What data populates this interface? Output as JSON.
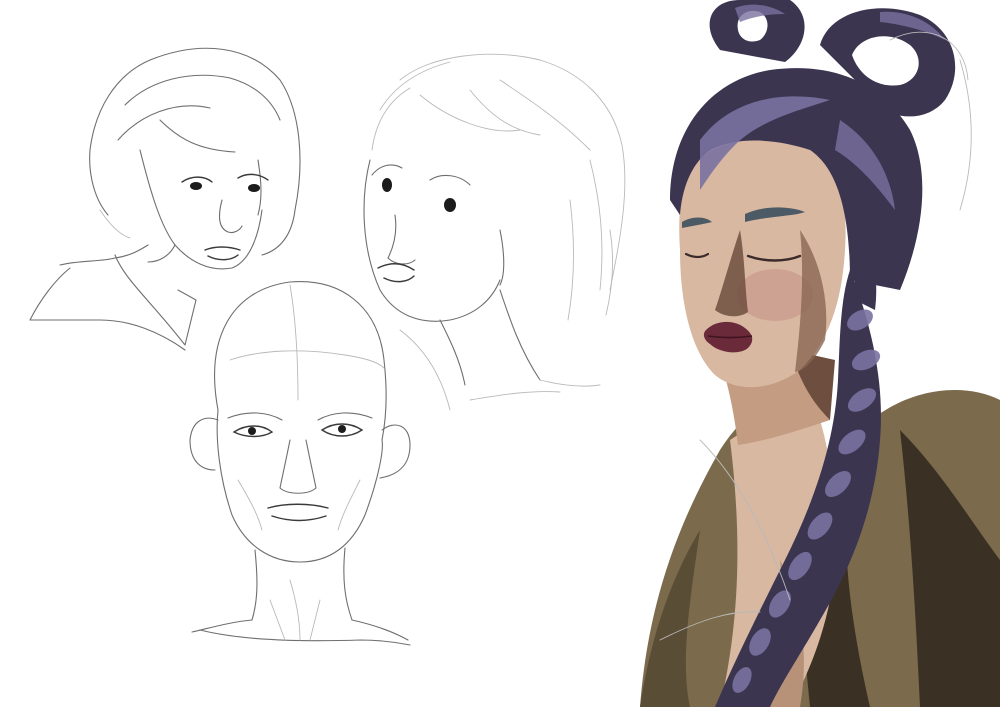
{
  "artwork": {
    "sketches": [
      {
        "name": "short-hair-woman-sketch"
      },
      {
        "name": "long-hair-woman-sketch"
      },
      {
        "name": "bald-man-sketch"
      }
    ],
    "painting": {
      "name": "braided-hair-woman-painting"
    },
    "colors": {
      "background": "#ffffff",
      "pencil": "#6f6f6f",
      "hair": "#3b3550",
      "hair_highlight": "#7a72a0",
      "skin": "#d8b8a0",
      "skin_shadow": "#6e4e3e",
      "lips": "#6b2a3a",
      "jacket": "#7b6a4c",
      "jacket_dark": "#3a3124"
    }
  }
}
